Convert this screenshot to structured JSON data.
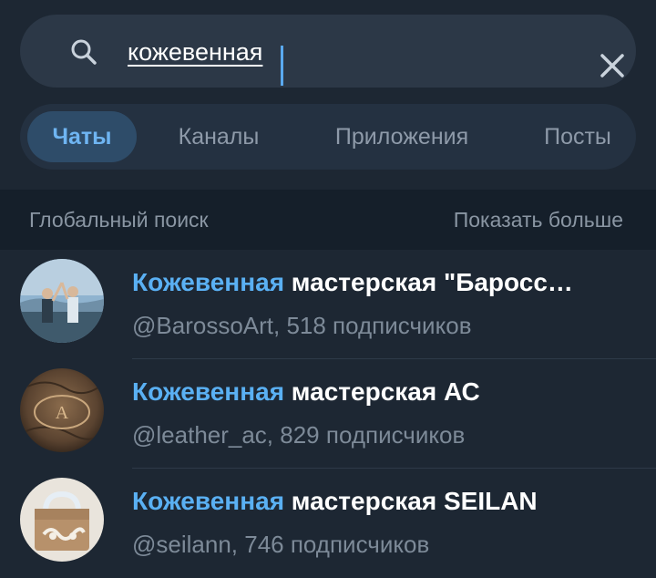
{
  "search": {
    "query": "кожевенная",
    "icons": {
      "search": "search-icon",
      "clear": "close-icon"
    }
  },
  "tabs": [
    {
      "label": "Чаты",
      "active": true
    },
    {
      "label": "Каналы",
      "active": false
    },
    {
      "label": "Приложения",
      "active": false
    },
    {
      "label": "Посты",
      "active": false
    }
  ],
  "section": {
    "title": "Глобальный поиск",
    "more": "Показать больше"
  },
  "results": [
    {
      "highlight": "Кожевенная",
      "rest": " мастерская \"Баросс…",
      "subtitle": "@BarossoArt, 518 подписчиков"
    },
    {
      "highlight": "Кожевенная",
      "rest": " мастерская АС",
      "subtitle": "@leather_ac, 829 подписчиков"
    },
    {
      "highlight": "Кожевенная",
      "rest": " мастерская SEILAN",
      "subtitle": "@seilann, 746 подписчиков"
    }
  ],
  "colors": {
    "accent": "#5ab0f3",
    "background": "#1d2733",
    "section_bg": "#151f2a"
  }
}
